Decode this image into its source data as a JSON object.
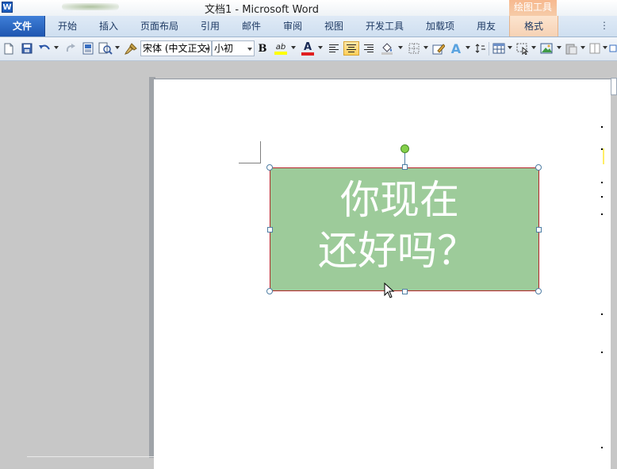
{
  "window": {
    "title": "文档1 - Microsoft Word",
    "app_icon_letter": "W",
    "context_tab_group": "绘图工具"
  },
  "ribbon": {
    "tabs": [
      {
        "label": "文件"
      },
      {
        "label": "开始"
      },
      {
        "label": "插入"
      },
      {
        "label": "页面布局"
      },
      {
        "label": "引用"
      },
      {
        "label": "邮件"
      },
      {
        "label": "审阅"
      },
      {
        "label": "视图"
      },
      {
        "label": "开发工具"
      },
      {
        "label": "加载项"
      },
      {
        "label": "用友"
      },
      {
        "label": "格式"
      }
    ],
    "more_indicator": "⋮"
  },
  "toolbar": {
    "font_name": "宋体 (中文正文)",
    "font_size": "小初",
    "bold": "B",
    "highlight_label": "ab",
    "font_color_label": "A",
    "text_effect_label": "A",
    "colors": {
      "highlight": "#ffff00",
      "font_color": "#e02020",
      "accent": "#ffcf5a"
    }
  },
  "document": {
    "shape_text_line1": "你现在",
    "shape_text_line2": "还好吗？",
    "shape_fill": "#9dcb9a",
    "shape_border": "#b5262b"
  }
}
